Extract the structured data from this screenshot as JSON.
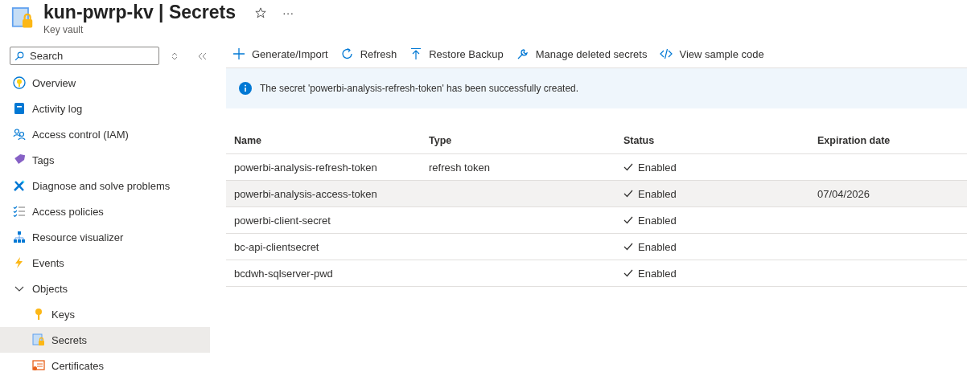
{
  "header": {
    "title": "kun-pwrp-kv | Secrets",
    "subtitle": "Key vault",
    "more": "···"
  },
  "sidebar": {
    "search": {
      "placeholder": "Search"
    },
    "items": [
      {
        "label": "Overview",
        "selected": false
      },
      {
        "label": "Activity log",
        "selected": false
      },
      {
        "label": "Access control (IAM)",
        "selected": false
      },
      {
        "label": "Tags",
        "selected": false
      },
      {
        "label": "Diagnose and solve problems",
        "selected": false
      },
      {
        "label": "Access policies",
        "selected": false
      },
      {
        "label": "Resource visualizer",
        "selected": false
      },
      {
        "label": "Events",
        "selected": false
      },
      {
        "label": "Objects",
        "selected": false,
        "expanded": true,
        "children": [
          {
            "label": "Keys",
            "selected": false
          },
          {
            "label": "Secrets",
            "selected": true
          },
          {
            "label": "Certificates",
            "selected": false
          }
        ]
      }
    ]
  },
  "toolbar": [
    "Generate/Import",
    "Refresh",
    "Restore Backup",
    "Manage deleted secrets",
    "View sample code"
  ],
  "banner": {
    "message": "The secret 'powerbi-analysis-refresh-token' has been successfully created."
  },
  "table": {
    "columns": [
      "Name",
      "Type",
      "Status",
      "Expiration date"
    ],
    "rows": [
      {
        "name": "powerbi-analysis-refresh-token",
        "type": "refresh token",
        "status": "Enabled",
        "selected": false
      },
      {
        "name": "powerbi-analysis-access-token",
        "status": "Enabled",
        "expiration": "07/04/2026",
        "selected": true
      },
      {
        "name": "powerbi-client-secret",
        "status": "Enabled",
        "selected": false
      },
      {
        "name": "bc-api-clientsecret",
        "status": "Enabled",
        "selected": false
      },
      {
        "name": "bcdwh-sqlserver-pwd",
        "status": "Enabled",
        "selected": false
      }
    ]
  }
}
